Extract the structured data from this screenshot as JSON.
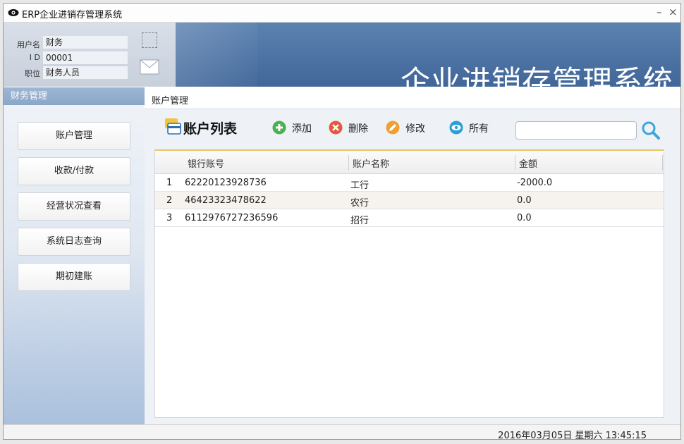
{
  "window": {
    "title": "ERP企业进销存管理系统",
    "minimize_label": "–",
    "close_label": "×"
  },
  "user": {
    "username_label": "用户名",
    "username": "财务",
    "id_label": "I D",
    "id": "00001",
    "role_label": "职位",
    "role": "财务人员"
  },
  "header": {
    "system_title": "企业进销存管理系统"
  },
  "sidebar": {
    "heading": "财务管理",
    "items": [
      {
        "label": "账户管理"
      },
      {
        "label": "收款/付款"
      },
      {
        "label": "经营状况查看"
      },
      {
        "label": "系统日志查询"
      },
      {
        "label": "期初建账"
      }
    ]
  },
  "main": {
    "breadcrumb": "账户管理",
    "list_title": "账户列表",
    "toolbar": {
      "add_label": "添加",
      "delete_label": "删除",
      "edit_label": "修改",
      "all_label": "所有"
    },
    "search": {
      "value": "",
      "placeholder": ""
    },
    "table": {
      "columns": [
        "银行账号",
        "账户名称",
        "金额"
      ],
      "rows": [
        {
          "index": "1",
          "account": "62220123928736",
          "name": "工行",
          "amount": "-2000.0"
        },
        {
          "index": "2",
          "account": "46423323478622",
          "name": "农行",
          "amount": "0.0"
        },
        {
          "index": "3",
          "account": "6112976727236596",
          "name": "招行",
          "amount": "0.0"
        }
      ]
    }
  },
  "status": {
    "datetime": "2016年03月05日   星期六   13:45:15"
  },
  "colors": {
    "header_blue": "#41679a",
    "add_green": "#4caf50",
    "delete_red": "#e25b3a",
    "edit_orange": "#f0a030",
    "all_blue": "#2a9fd6",
    "table_top_accent": "#e7c56a"
  }
}
